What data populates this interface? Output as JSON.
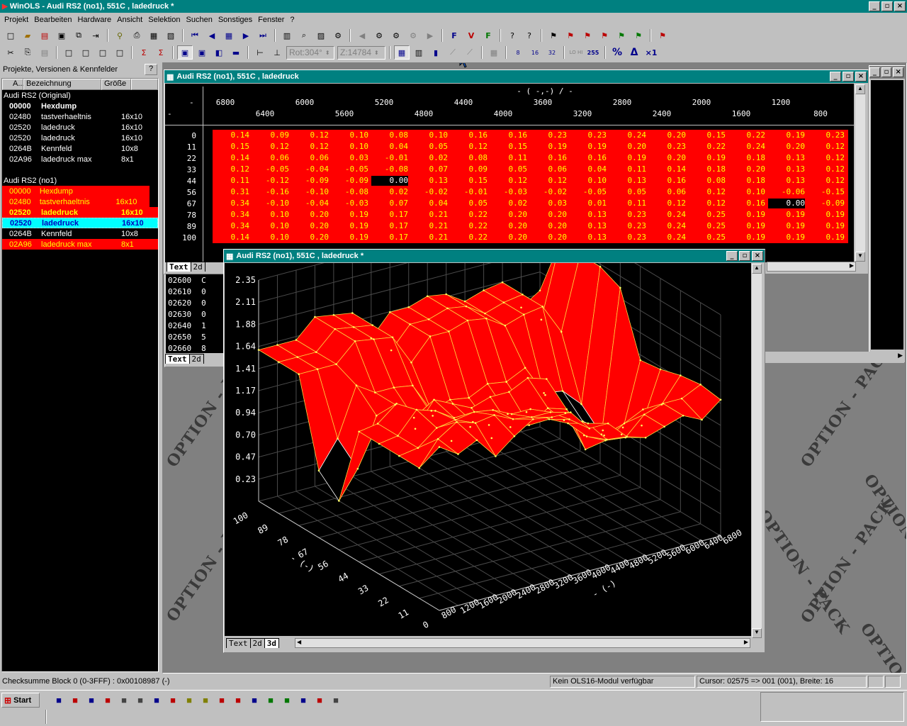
{
  "app": {
    "title": "WinOLS - Audi RS2 (no1), 551C , ladedruck *"
  },
  "menu": [
    "Projekt",
    "Bearbeiten",
    "Hardware",
    "Ansicht",
    "Selektion",
    "Suchen",
    "Sonstiges",
    "Fenster",
    "?"
  ],
  "toolbar2": {
    "rot": "Rot:304°",
    "z": "Z:14784"
  },
  "left": {
    "title": "Projekte, Versionen & Kennfelder",
    "help": "?",
    "cols": [
      "A...",
      "Bezeichnung",
      "Größe"
    ],
    "group1": "Audi RS2 (Original)",
    "items1": [
      {
        "addr": "00000",
        "name": "Hexdump",
        "size": ""
      },
      {
        "addr": "02480",
        "name": "tastverhaeltnis",
        "size": "16x10"
      },
      {
        "addr": "02520",
        "name": "ladedruck",
        "size": "16x10"
      },
      {
        "addr": "02520",
        "name": "ladedruck",
        "size": "16x10"
      },
      {
        "addr": "0264B",
        "name": "Kennfeld",
        "size": "10x8"
      },
      {
        "addr": "02A96",
        "name": "ladedruck max",
        "size": "8x1"
      }
    ],
    "group2": "Audi RS2 (no1)",
    "items2": [
      {
        "addr": "00000",
        "name": "Hexdump",
        "size": ""
      },
      {
        "addr": "02480",
        "name": "tastverhaeltnis",
        "size": "16x10"
      },
      {
        "addr": "02520",
        "name": "ladedruck",
        "size": "16x10"
      },
      {
        "addr": "02520",
        "name": "ladedruck",
        "size": "16x10"
      },
      {
        "addr": "0264B",
        "name": "Kennfeld",
        "size": "10x8"
      },
      {
        "addr": "02A96",
        "name": "ladedruck max",
        "size": "8x1"
      }
    ]
  },
  "table_win": {
    "title": "Audi RS2 (no1), 551C , ladedruck",
    "axis_title": "- ( -,-) / -",
    "unit_top": "-",
    "unit_left": "-",
    "xlabels_top": [
      "6800",
      "6000",
      "5200",
      "4400",
      "3600",
      "2800",
      "2000",
      "1200"
    ],
    "xlabels_bottom": [
      "6400",
      "5600",
      "4800",
      "4000",
      "3200",
      "2400",
      "1600",
      "800"
    ],
    "ylabels": [
      "0",
      "11",
      "22",
      "33",
      "44",
      "56",
      "67",
      "78",
      "89",
      "100"
    ],
    "rows": [
      [
        "0.14",
        "0.09",
        "0.12",
        "0.10",
        "0.08",
        "0.10",
        "0.16",
        "0.16",
        "0.23",
        "0.23",
        "0.24",
        "0.20",
        "0.15",
        "0.22",
        "0.19",
        "0.23"
      ],
      [
        "0.15",
        "0.12",
        "0.12",
        "0.10",
        "0.04",
        "0.05",
        "0.12",
        "0.15",
        "0.19",
        "0.19",
        "0.20",
        "0.23",
        "0.22",
        "0.24",
        "0.20",
        "0.12"
      ],
      [
        "0.14",
        "0.06",
        "0.06",
        "0.03",
        "-0.01",
        "0.02",
        "0.08",
        "0.11",
        "0.16",
        "0.16",
        "0.19",
        "0.20",
        "0.19",
        "0.18",
        "0.13",
        "0.12"
      ],
      [
        "0.12",
        "-0.05",
        "-0.04",
        "-0.05",
        "-0.08",
        "0.07",
        "0.09",
        "0.05",
        "0.06",
        "0.04",
        "0.11",
        "0.14",
        "0.18",
        "0.20",
        "0.13",
        "0.12"
      ],
      [
        "0.11",
        "-0.12",
        "-0.09",
        "-0.09",
        "0.00",
        "0.13",
        "0.15",
        "0.12",
        "0.12",
        "0.10",
        "0.13",
        "0.16",
        "0.08",
        "0.18",
        "0.13",
        "0.12"
      ],
      [
        "0.31",
        "-0.16",
        "-0.10",
        "-0.08",
        "0.02",
        "-0.02",
        "-0.01",
        "-0.03",
        "-0.02",
        "-0.05",
        "0.05",
        "0.06",
        "0.12",
        "0.10",
        "-0.06",
        "-0.15"
      ],
      [
        "0.34",
        "-0.10",
        "-0.04",
        "-0.03",
        "0.07",
        "0.04",
        "0.05",
        "0.02",
        "0.03",
        "0.01",
        "0.11",
        "0.12",
        "0.12",
        "0.16",
        "0.00",
        "-0.09"
      ],
      [
        "0.34",
        "0.10",
        "0.20",
        "0.19",
        "0.17",
        "0.21",
        "0.22",
        "0.20",
        "0.20",
        "0.13",
        "0.23",
        "0.24",
        "0.25",
        "0.19",
        "0.19",
        "0.19"
      ],
      [
        "0.34",
        "0.10",
        "0.20",
        "0.19",
        "0.17",
        "0.21",
        "0.22",
        "0.20",
        "0.20",
        "0.13",
        "0.23",
        "0.24",
        "0.25",
        "0.19",
        "0.19",
        "0.19"
      ],
      [
        "0.14",
        "0.10",
        "0.20",
        "0.19",
        "0.17",
        "0.21",
        "0.22",
        "0.20",
        "0.20",
        "0.13",
        "0.23",
        "0.24",
        "0.25",
        "0.19",
        "0.19",
        "0.19"
      ]
    ],
    "tabs": [
      "Text",
      "2d"
    ]
  },
  "hex_win": {
    "rows": [
      {
        "addr": "02600",
        "v": "C"
      },
      {
        "addr": "02610",
        "v": "0"
      },
      {
        "addr": "02620",
        "v": "0"
      },
      {
        "addr": "02630",
        "v": "0"
      },
      {
        "addr": "02640",
        "v": "1"
      },
      {
        "addr": "02650",
        "v": "5"
      },
      {
        "addr": "02660",
        "v": "8"
      }
    ],
    "tabs": [
      "Text",
      "2d"
    ]
  },
  "view3d": {
    "title": "Audi RS2 (no1), 551C , ladedruck *",
    "zticks": [
      "2.35",
      "2.11",
      "1.88",
      "1.64",
      "1.41",
      "1.17",
      "0.94",
      "0.70",
      "0.47",
      "0.23"
    ],
    "yticks": [
      "100",
      "89",
      "78",
      "67",
      "56",
      "44",
      "33",
      "22",
      "11",
      "0"
    ],
    "xticks": [
      "800",
      "1200",
      "1600",
      "2000",
      "2400",
      "2800",
      "3200",
      "3600",
      "4000",
      "4400",
      "4800",
      "5200",
      "5600",
      "6000",
      "6400",
      "6800"
    ],
    "ylabel": "- (-)",
    "xlabel": "- (-)",
    "tabs": [
      "Text",
      "2d",
      "3d"
    ]
  },
  "watermark": "OPTION - PACK",
  "status": {
    "checksum": "Checksumme Block 0 (0-3FFF) : 0x00108987 (-)",
    "module": "Kein OLS16-Modul verfügbar",
    "cursor": "Cursor: 02575 => 001 (001), Breite: 16"
  },
  "taskbar": {
    "start": "Start"
  },
  "colors": {
    "title": "#008080",
    "map": "#ff0000",
    "highlight": "#00ffff",
    "sel_text": "#ffff00"
  }
}
